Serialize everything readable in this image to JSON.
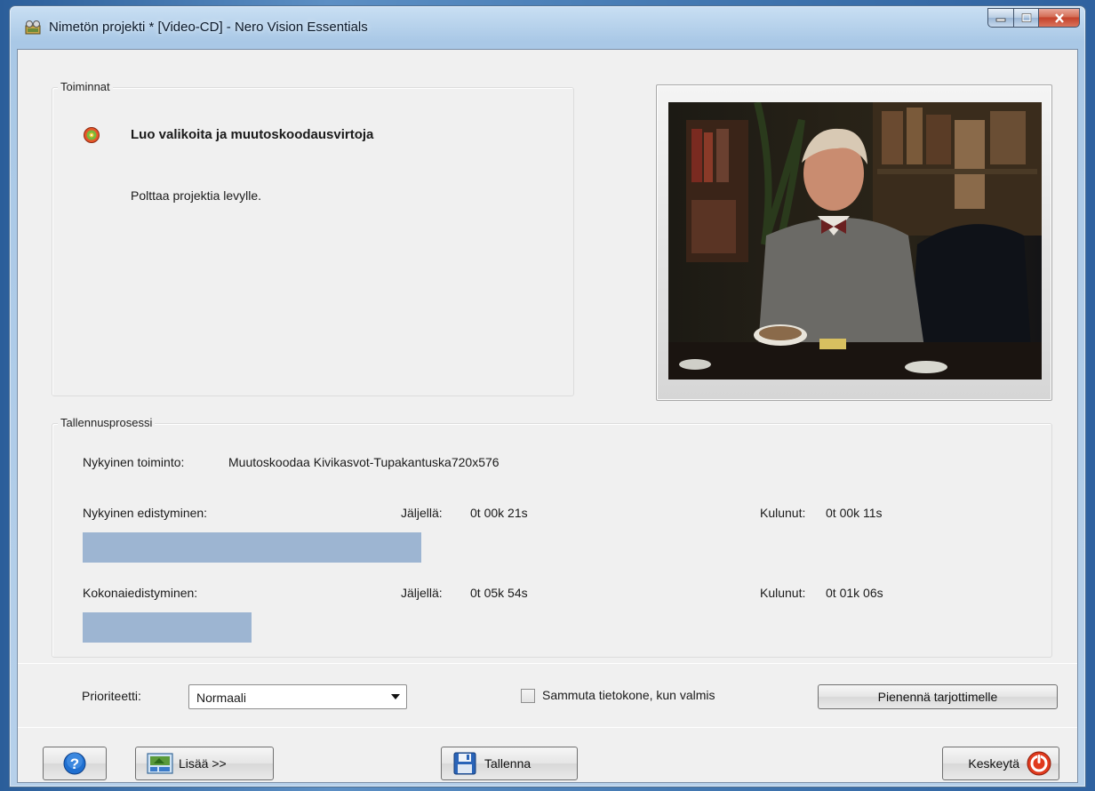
{
  "window": {
    "title": "Nimetön projekti * [Video-CD] - Nero Vision Essentials"
  },
  "actions": {
    "group_label": "Toiminnat",
    "title": "Luo valikoita ja muutoskoodausvirtoja",
    "description": "Polttaa projektia levylle."
  },
  "process": {
    "group_label": "Tallennusprosessi",
    "current_action_label": "Nykyinen toiminto:",
    "current_action_value": "Muutoskoodaa Kivikasvot-Tupakantuska720x576",
    "current_progress": {
      "label": "Nykyinen edistyminen:",
      "remaining_label": "Jäljellä:",
      "remaining_value": "0t 00k 21s",
      "elapsed_label": "Kulunut:",
      "elapsed_value": "0t 00k 11s",
      "fraction": 0.34
    },
    "total_progress": {
      "label": "Kokonaiedistyminen:",
      "remaining_label": "Jäljellä:",
      "remaining_value": "0t 05k 54s",
      "elapsed_label": "Kulunut:",
      "elapsed_value": "0t 01k 06s",
      "fraction": 0.17
    }
  },
  "options": {
    "priority_label": "Prioriteetti:",
    "priority_value": "Normaali",
    "shutdown_label": "Sammuta tietokone, kun valmis",
    "shutdown_checked": false,
    "minimize_button": "Pienennä tarjottimelle"
  },
  "footer": {
    "more_button": "Lisää >>",
    "save_button": "Tallenna",
    "abort_button": "Keskeytä"
  },
  "colors": {
    "progress_fill": "#9db5d2",
    "help_icon": "#1f6fd0",
    "abort_icon": "#e03a1e"
  },
  "icons": {
    "app": "film-projector-icon",
    "action": "disc-burn-icon",
    "help": "help-icon",
    "more": "expand-panel-icon",
    "save": "floppy-disk-icon",
    "abort": "stop-icon"
  }
}
